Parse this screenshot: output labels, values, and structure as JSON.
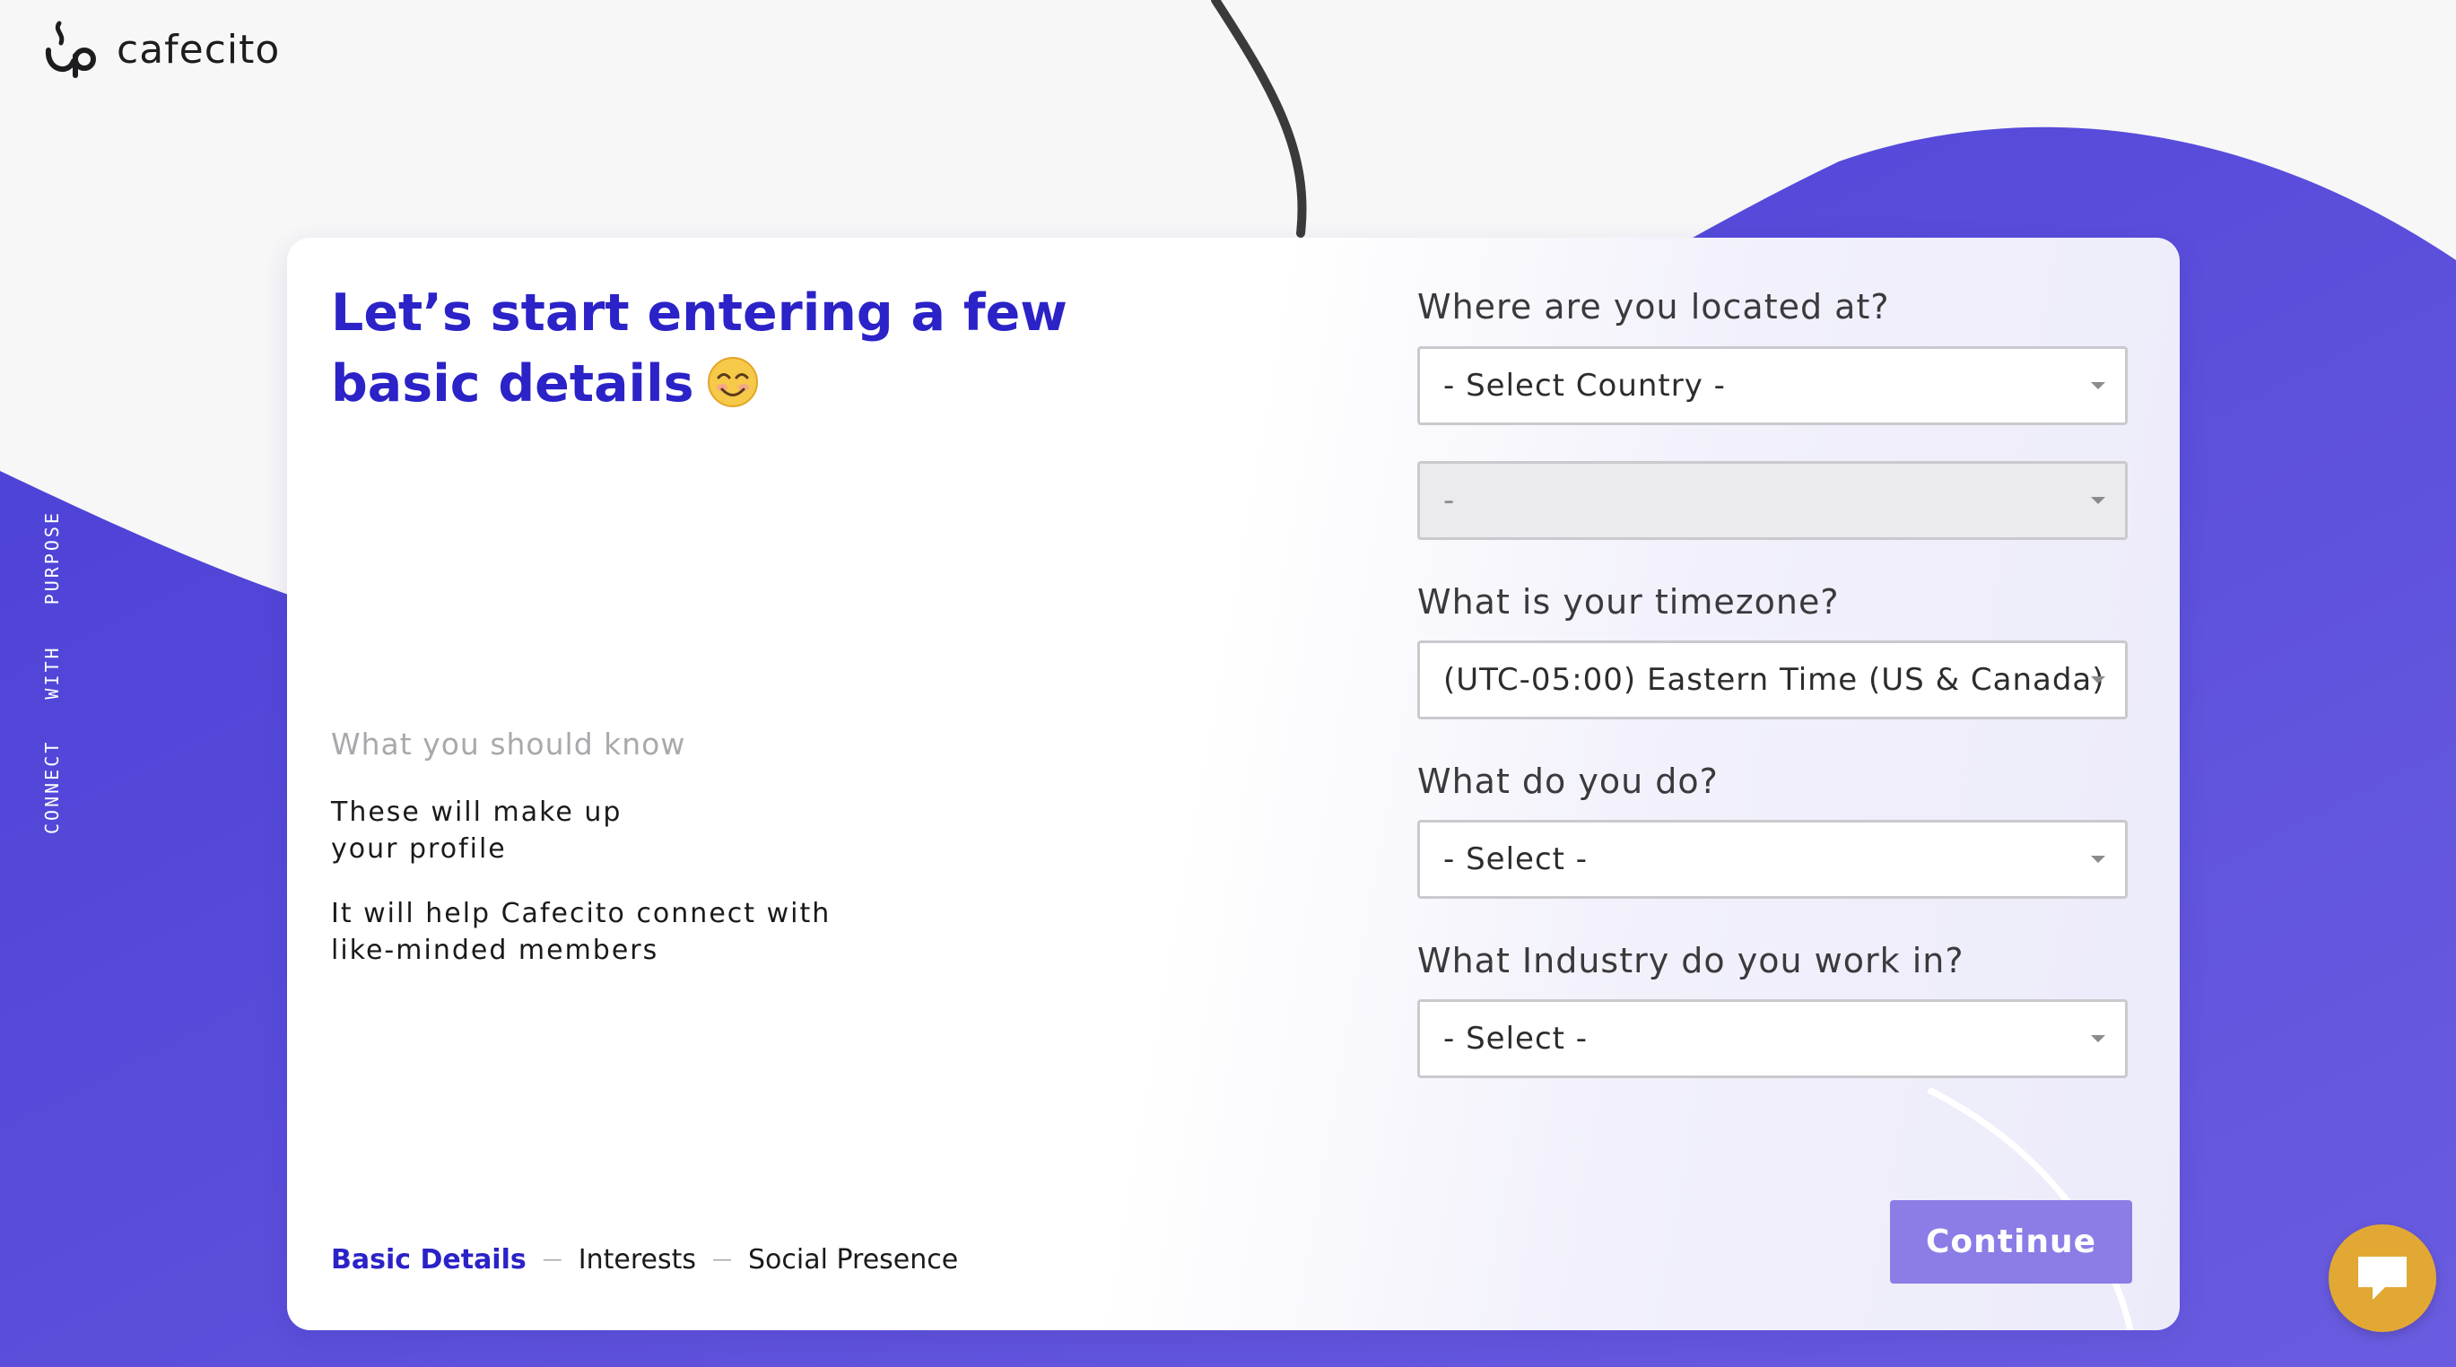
{
  "brand": {
    "name": "cafecito",
    "tagline": "CONNECT   WITH   PURPOSE"
  },
  "intro": {
    "headline": "Let’s start entering a few basic details",
    "emoji_icon": "smiling-face-icon"
  },
  "info": {
    "title": "What you should know",
    "paragraph1": "These will make up\nyour profile",
    "paragraph2": "It will help Cafecito connect with\nlike-minded members"
  },
  "steps": [
    {
      "label": "Basic Details",
      "active": true
    },
    {
      "label": "Interests",
      "active": false
    },
    {
      "label": "Social Presence",
      "active": false
    }
  ],
  "step_separator": "—",
  "form": {
    "location": {
      "label": "Where are you located at?",
      "country_value": "- Select Country -",
      "region_value": "-"
    },
    "timezone": {
      "label": "What is your timezone?",
      "value": "(UTC-05:00) Eastern Time (US & Canada)"
    },
    "occupation": {
      "label": "What do you do?",
      "value": "- Select -"
    },
    "industry": {
      "label": "What Industry do you work in?",
      "value": "- Select -"
    }
  },
  "actions": {
    "continue_label": "Continue"
  },
  "colors": {
    "accent": "#2b22c7",
    "background_blob": "#5a4bdc",
    "button": "#8a7de6",
    "chat_button": "#e1a834"
  },
  "chat": {
    "icon": "chat-bubble-icon"
  }
}
